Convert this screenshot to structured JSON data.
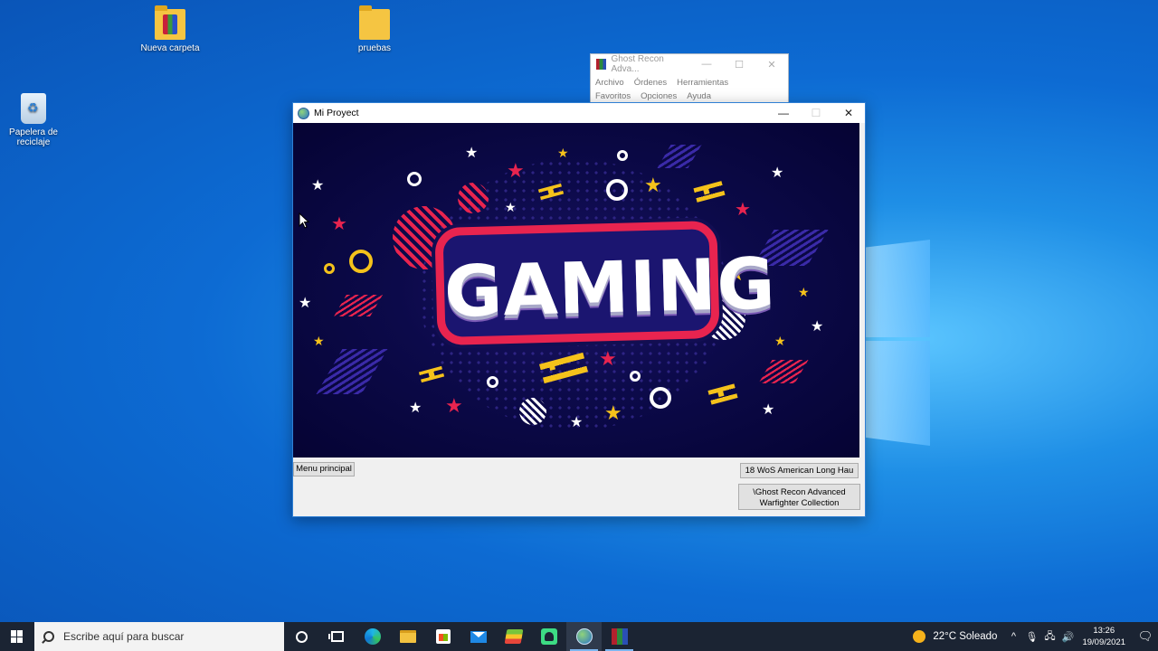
{
  "desktop": {
    "icons": [
      {
        "label": "Nueva carpeta",
        "icon": "folder-icon"
      },
      {
        "label": "pruebas",
        "icon": "folder-icon"
      },
      {
        "label": "Papelera de reciclaje",
        "icon": "recycle-bin-icon"
      }
    ]
  },
  "background_window": {
    "title": "Ghost Recon Adva...",
    "menu": [
      "Archivo",
      "Órdenes",
      "Herramientas",
      "Favoritos",
      "Opciones",
      "Ayuda"
    ]
  },
  "main_window": {
    "title": "Mi Proyect",
    "banner_text": "GAMING",
    "buttons": {
      "menu_principal": "Menu principal",
      "wos": "18 WoS American Long Hau",
      "ghost_recon_line1": "\\Ghost Recon Advanced",
      "ghost_recon_line2": "Warfighter Collection"
    }
  },
  "taskbar": {
    "search_placeholder": "Escribe aquí para buscar",
    "weather": "22°C  Soleado",
    "time": "13:26",
    "date": "19/09/2021"
  },
  "colors": {
    "desktop_blue": "#0d6bd3",
    "taskbar": "#1b2433",
    "gaming_red": "#e8244f",
    "gaming_yellow": "#f5c21b",
    "banner_navy": "#0c0a4a"
  }
}
